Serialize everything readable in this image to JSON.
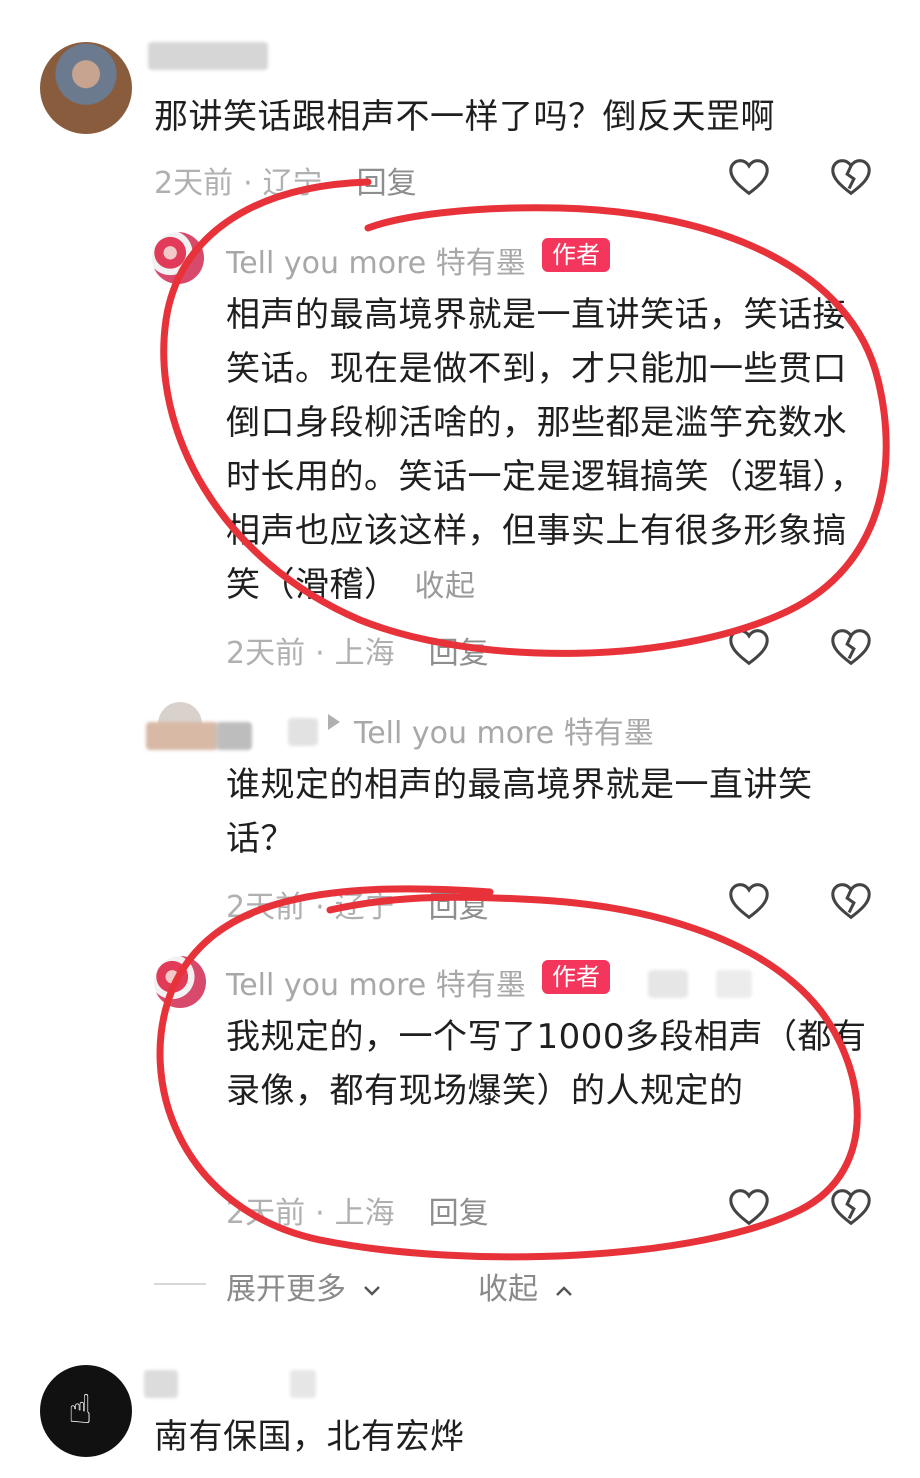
{
  "comment_top": {
    "text": "那讲笑话跟相声不一样了吗？倒反天罡啊",
    "time": "2天前",
    "location": "辽宁",
    "reply": "回复"
  },
  "author_reply_1": {
    "username": "Tell you more 特有墨",
    "badge": "作者",
    "text": "相声的最高境界就是一直讲笑话，笑话接笑话。现在是做不到，才只能加一些贯口倒口身段柳活啥的，那些都是滥竽充数水时长用的。笑话一定是逻辑搞笑（逻辑），相声也应该这样，但事实上有很多形象搞笑（滑稽）",
    "collapse": "收起",
    "time": "2天前",
    "location": "上海",
    "reply": "回复"
  },
  "user_reply": {
    "target": "Tell you more 特有墨",
    "text": "谁规定的相声的最高境界就是一直讲笑话？",
    "time": "2天前",
    "location": "辽宁",
    "reply": "回复"
  },
  "author_reply_2": {
    "username": "Tell you more 特有墨",
    "badge": "作者",
    "text": "我规定的，一个写了1000多段相声（都有录像，都有现场爆笑）的人规定的",
    "time": "2天前",
    "location": "上海",
    "reply": "回复"
  },
  "thread_footer": {
    "expand": "展开更多",
    "collapse": "收起"
  },
  "comment_bottom": {
    "text": "南有保国，北有宏烨"
  },
  "colors": {
    "badge": "#f5365c",
    "annotation_circle": "#e8323a",
    "meta": "#b0b0b0"
  }
}
